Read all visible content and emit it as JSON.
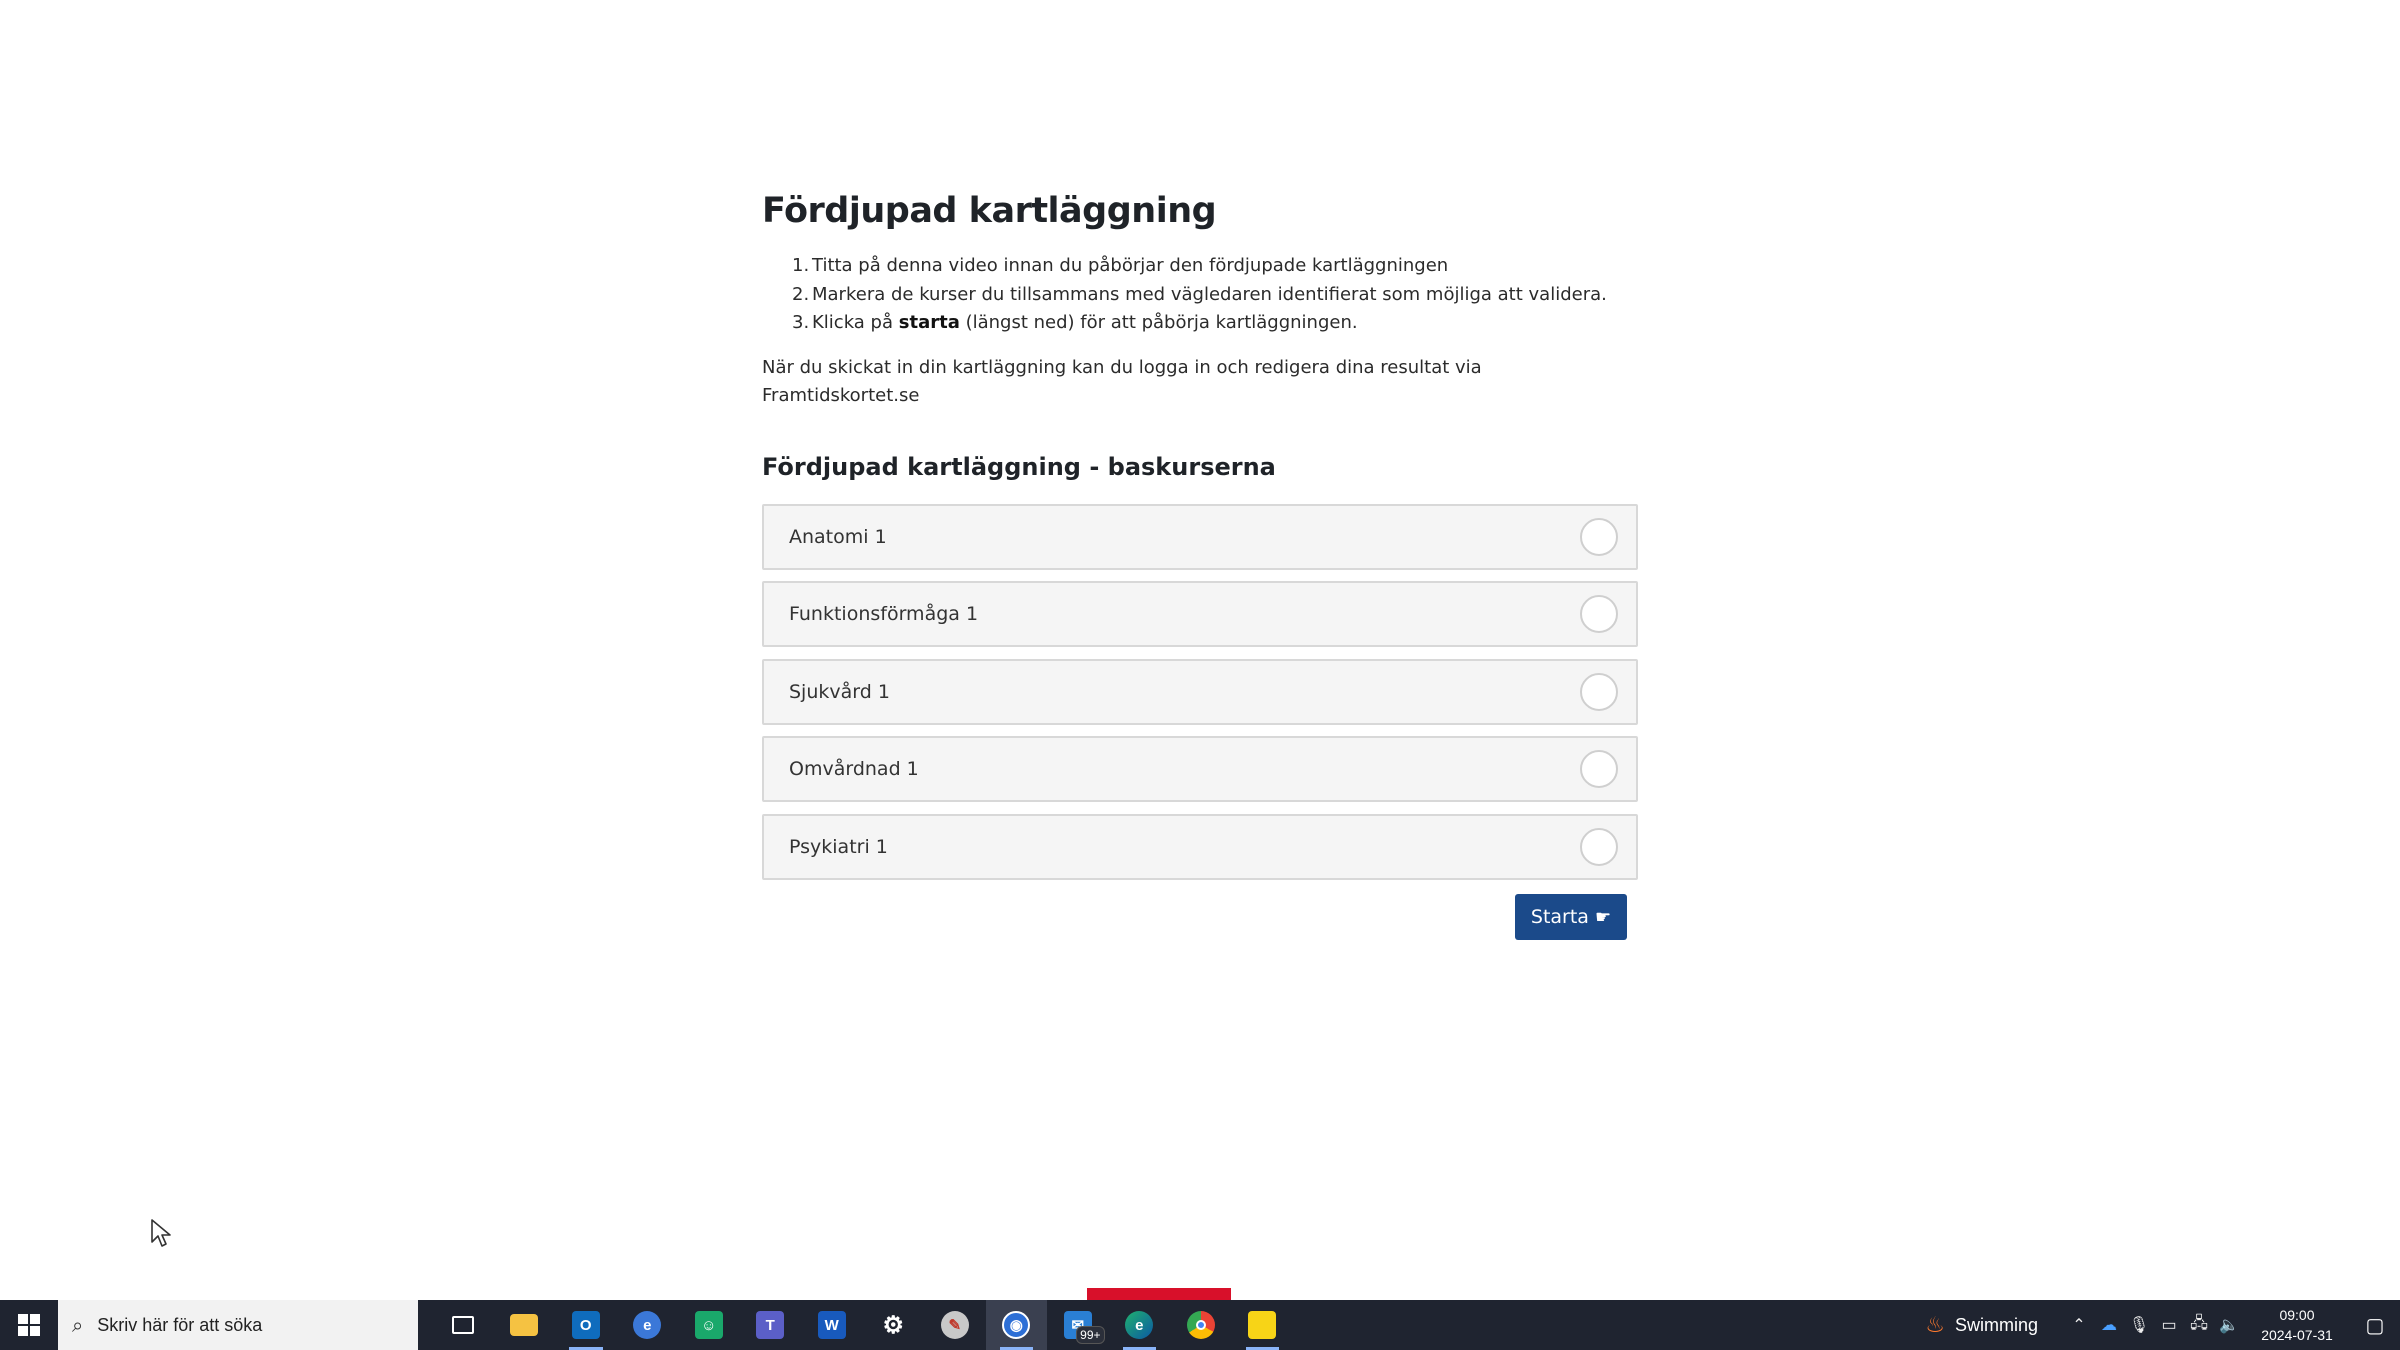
{
  "page": {
    "title": "Fördjupad kartläggning",
    "steps": [
      {
        "num": "1.",
        "text": "Titta på denna video innan du påbörjar den fördjupade kartläggningen"
      },
      {
        "num": "2.",
        "text": "Markera de kurser du tillsammans med vägledaren identifierat som möjliga att validera."
      },
      {
        "num": "3.",
        "pre": "Klicka på ",
        "bold": "starta",
        "post": " (längst ned) för att påbörja kartläggningen."
      }
    ],
    "note": "När du skickat in din kartläggning kan du logga in och redigera dina resultat via Framtidskortet.se",
    "section_title": "Fördjupad kartläggning - baskurserna",
    "courses": [
      {
        "label": "Anatomi 1",
        "selected": false
      },
      {
        "label": "Funktionsförmåga 1",
        "selected": false
      },
      {
        "label": "Sjukvård 1",
        "selected": false
      },
      {
        "label": "Omvårdnad 1",
        "selected": false
      },
      {
        "label": "Psykiatri 1",
        "selected": false
      }
    ],
    "start_label": "Starta",
    "start_icon": "hand-pointing-icon",
    "accent_color": "#1b4a8a"
  },
  "taskbar": {
    "search_placeholder": "Skriv här för att söka",
    "apps": [
      {
        "name": "task-view",
        "icon": "task-view-icon"
      },
      {
        "name": "file-explorer",
        "icon": "folder-icon"
      },
      {
        "name": "outlook",
        "icon": "outlook-icon"
      },
      {
        "name": "app-blue",
        "icon": "app-icon"
      },
      {
        "name": "app-green",
        "icon": "app-icon"
      },
      {
        "name": "teams",
        "icon": "teams-icon"
      },
      {
        "name": "word",
        "icon": "word-icon"
      },
      {
        "name": "settings",
        "icon": "gear-icon"
      },
      {
        "name": "app-brush",
        "icon": "app-icon"
      },
      {
        "name": "app-active",
        "icon": "app-icon"
      },
      {
        "name": "app-badge",
        "icon": "app-icon",
        "badge": "99+"
      },
      {
        "name": "edge",
        "icon": "edge-icon"
      },
      {
        "name": "chrome",
        "icon": "chrome-icon"
      },
      {
        "name": "sticky-notes",
        "icon": "sticky-notes-icon"
      }
    ],
    "weather_label": "Swimming",
    "time": "09:00",
    "date": "2024-07-31"
  }
}
